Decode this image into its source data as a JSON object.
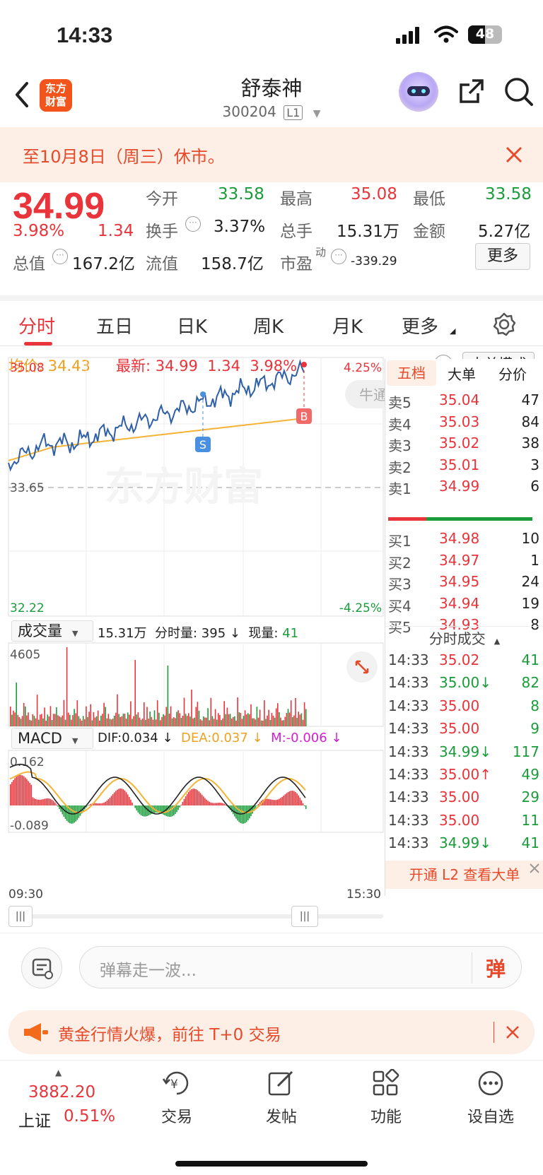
{
  "status": {
    "time": "14:33",
    "battery": "48"
  },
  "header": {
    "title": "舒泰神",
    "code": "300204",
    "level": "L1",
    "logo": "东方财富"
  },
  "banner": {
    "text": "至10月8日（周三）休市。"
  },
  "quote": {
    "price": "34.99",
    "pct": "3.98%",
    "chg": "1.34",
    "open_label": "今开",
    "open": "33.58",
    "high_label": "最高",
    "high": "35.08",
    "low_label": "最低",
    "low": "33.58",
    "turnover_label": "换手",
    "turnover": "3.37%",
    "vol_label": "总手",
    "vol": "15.31万",
    "amount_label": "金额",
    "amount": "5.27亿",
    "mcap_label": "总值",
    "mcap": "167.2亿",
    "float_label": "流值",
    "float": "158.7亿",
    "pe_label": "市盈",
    "pe_sup": "动",
    "pe": "-339.29",
    "more": "更多"
  },
  "tabs": [
    "分时",
    "五日",
    "日K",
    "周K",
    "月K",
    "更多"
  ],
  "chart": {
    "avg_label": "均价:",
    "avg": "34.43",
    "last_label": "最新:",
    "last": "34.99",
    "last_chg": "1.34",
    "last_pct": "3.98%",
    "mode_btn": "大单模式",
    "help": "?",
    "y_top": "35.08",
    "y_mid": "33.65",
    "y_bot": "32.22",
    "pct_top": "4.25%",
    "pct_bot": "-4.25%",
    "watermark": "东方财富",
    "marker_s": "S",
    "marker_b": "B",
    "bull_label": "牛通",
    "vol_selector": "成交量",
    "vol_total": "15.31万",
    "vol_period_label": "分时量:",
    "vol_period": "395 ↓",
    "vol_now_label": "现量:",
    "vol_now": "41",
    "vol_max": "4605",
    "macd_selector": "MACD",
    "dif": "DIF:0.034 ↓",
    "dea": "DEA:0.037 ↓",
    "m": "M:-0.006 ↓",
    "macd_top": "0.162",
    "macd_bot": "-0.089",
    "time_start": "09:30",
    "time_end": "15:30"
  },
  "orderbook": {
    "tabs": [
      "五档",
      "大单",
      "分价"
    ],
    "asks": [
      {
        "l": "卖5",
        "p": "35.04",
        "v": "47"
      },
      {
        "l": "卖4",
        "p": "35.03",
        "v": "84"
      },
      {
        "l": "卖3",
        "p": "35.02",
        "v": "38"
      },
      {
        "l": "卖2",
        "p": "35.01",
        "v": "3"
      },
      {
        "l": "卖1",
        "p": "34.99",
        "v": "6"
      }
    ],
    "bids": [
      {
        "l": "买1",
        "p": "34.98",
        "v": "10"
      },
      {
        "l": "买2",
        "p": "34.97",
        "v": "1"
      },
      {
        "l": "买3",
        "p": "34.95",
        "v": "24"
      },
      {
        "l": "买4",
        "p": "34.94",
        "v": "19"
      },
      {
        "l": "买5",
        "p": "34.93",
        "v": "8"
      }
    ],
    "ticks_title": "分时成交",
    "ticks": [
      {
        "t": "14:33",
        "p": "35.02",
        "v": "41"
      },
      {
        "t": "14:33",
        "p": "35.00↓",
        "v": "82"
      },
      {
        "t": "14:33",
        "p": "35.00",
        "v": "8"
      },
      {
        "t": "14:33",
        "p": "35.00",
        "v": "9"
      },
      {
        "t": "14:33",
        "p": "34.99↓",
        "v": "117"
      },
      {
        "t": "14:33",
        "p": "35.00↑",
        "v": "49"
      },
      {
        "t": "14:33",
        "p": "35.00",
        "v": "29"
      },
      {
        "t": "14:33",
        "p": "35.00",
        "v": "11"
      },
      {
        "t": "14:33",
        "p": "34.99↓",
        "v": "41"
      }
    ],
    "l2": "开通 L2 查看大单"
  },
  "input": {
    "placeholder": "弹幕走一波...",
    "send": "弹"
  },
  "ad": {
    "text": "黄金行情火爆，前往 T+0 交易"
  },
  "bottom": {
    "index_val": "3882.20",
    "index_name": "上证",
    "index_pct": "0.51%",
    "items": [
      "交易",
      "发帖",
      "功能",
      "设自选"
    ]
  }
}
